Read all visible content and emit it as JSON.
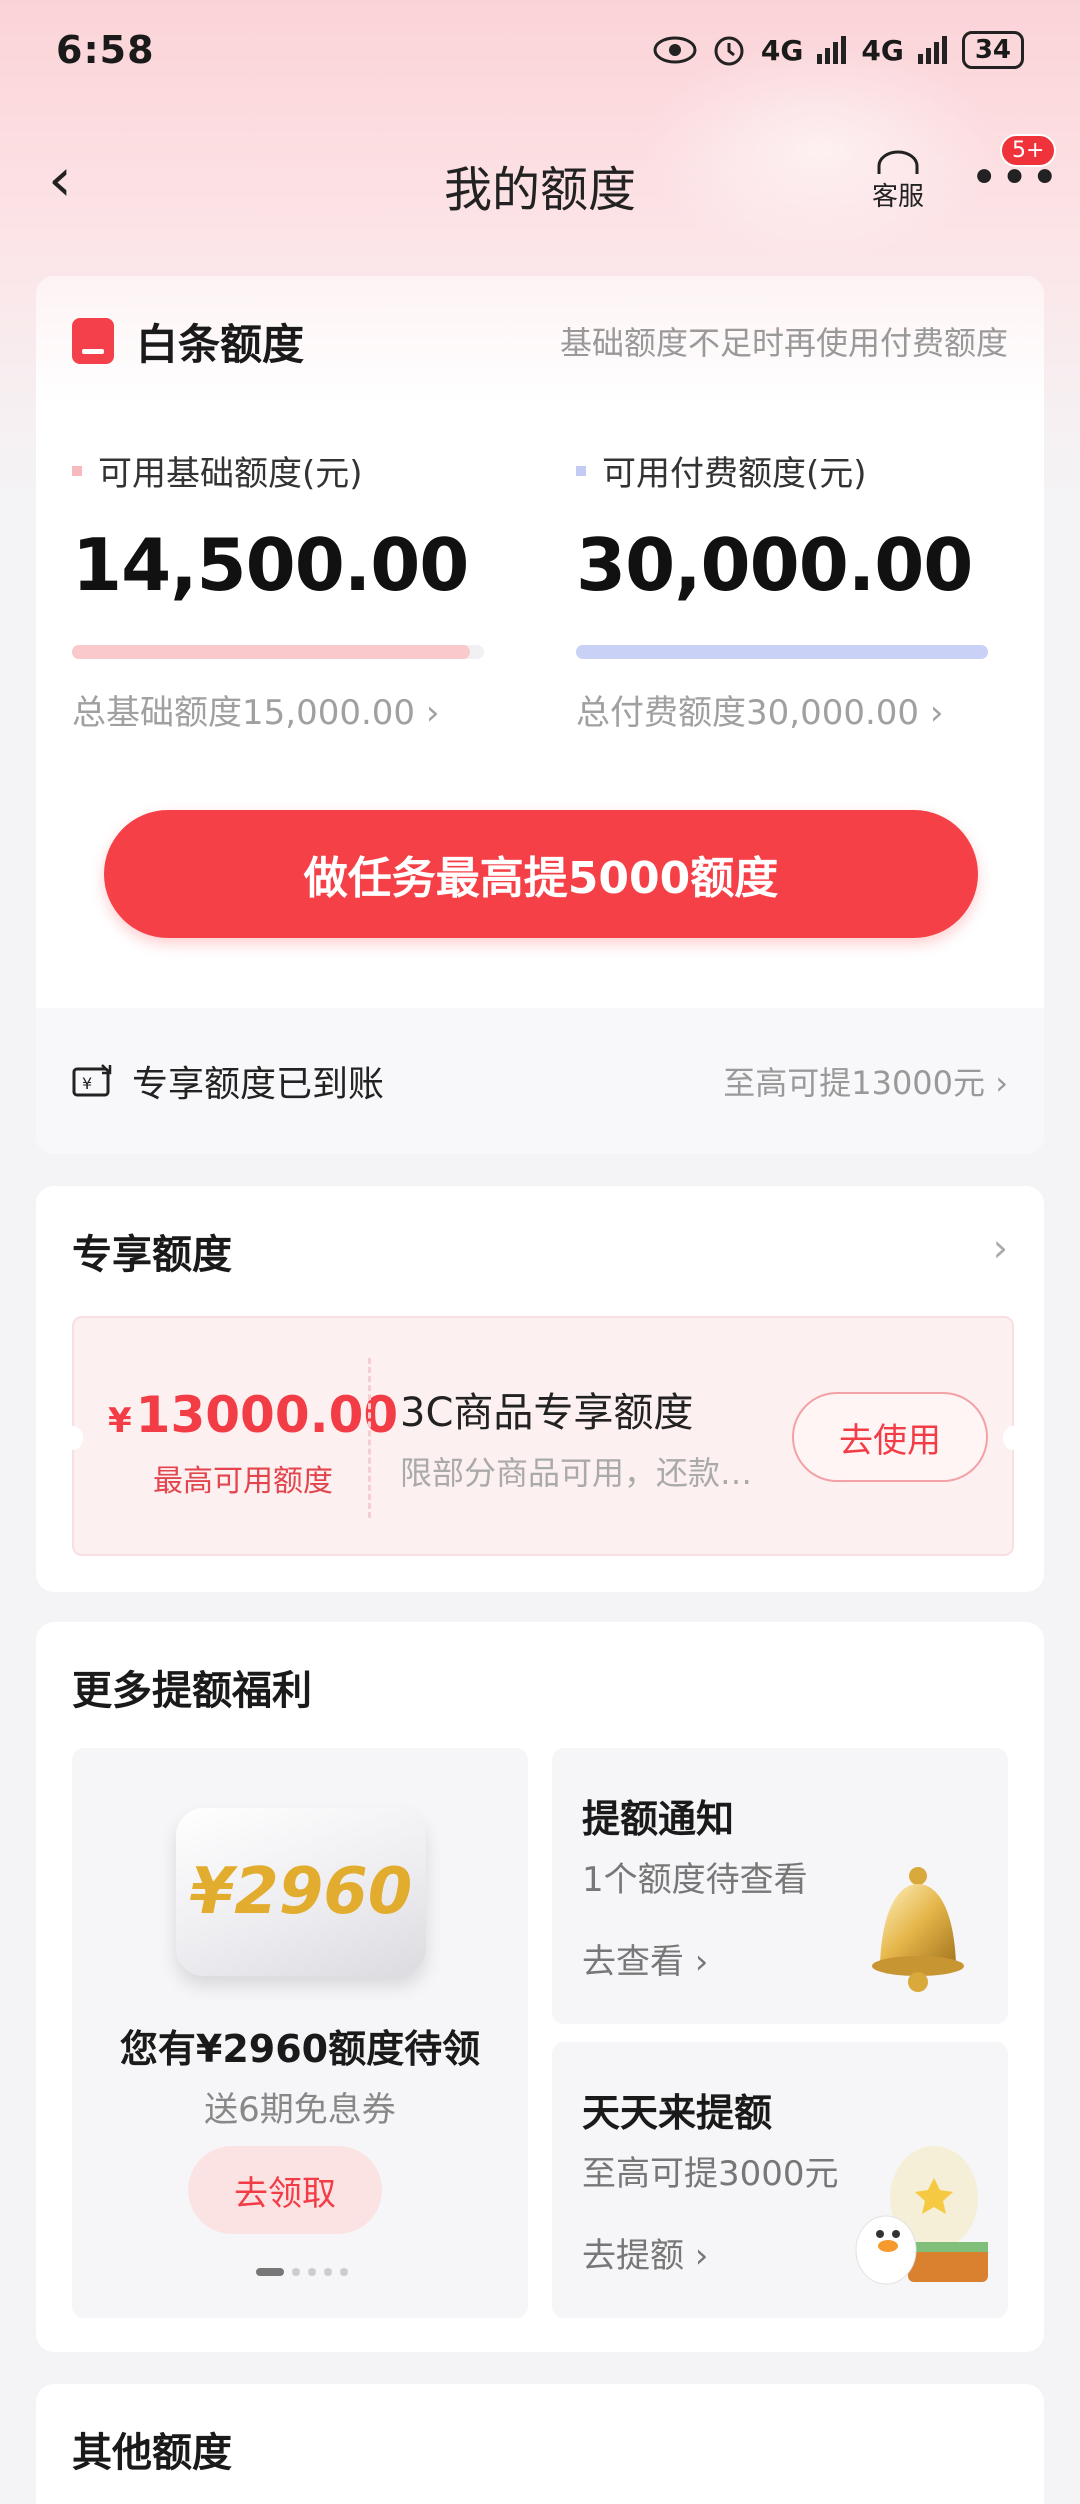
{
  "status_bar": {
    "time": "6:58",
    "signal1": "4G",
    "signal2": "4G",
    "battery": "34"
  },
  "nav": {
    "title": "我的额度",
    "service_label": "客服",
    "more_badge": "5+"
  },
  "baitiao": {
    "name": "白条额度",
    "note": "基础额度不足时再使用付费额度",
    "base": {
      "label": "可用基础额度(元)",
      "value": "14,500.00",
      "total": "总基础额度15,000.00",
      "used_fraction": 0.967,
      "color": "#f9c9cc"
    },
    "paid": {
      "label": "可用付费额度(元)",
      "value": "30,000.00",
      "total": "总付费额度30,000.00",
      "used_fraction": 1.0,
      "color": "#c9d1f6"
    },
    "cta": "做任务最高提5000额度",
    "footer_left": "专享额度已到账",
    "footer_right": "至高可提13000元"
  },
  "exclusive": {
    "title": "专享额度",
    "amount_symbol": "¥",
    "amount": "13000.00",
    "amount_caption": "最高可用额度",
    "product": "3C商品专享额度",
    "desc": "限部分商品可用，还款…",
    "button": "去使用"
  },
  "benefits": {
    "title": "更多提额福利",
    "promo": {
      "image_text": "¥2960",
      "title": "您有¥2960额度待领",
      "sub": "送6期免息券",
      "button": "去领取"
    },
    "notice": {
      "title": "提额通知",
      "sub": "1个额度待查看",
      "link": "去查看"
    },
    "daily": {
      "title": "天天来提额",
      "sub": "至高可提3000元",
      "link": "去提额"
    }
  },
  "other": {
    "title": "其他额度"
  },
  "colors": {
    "accent": "#f64048",
    "brand": "#f4404a"
  }
}
